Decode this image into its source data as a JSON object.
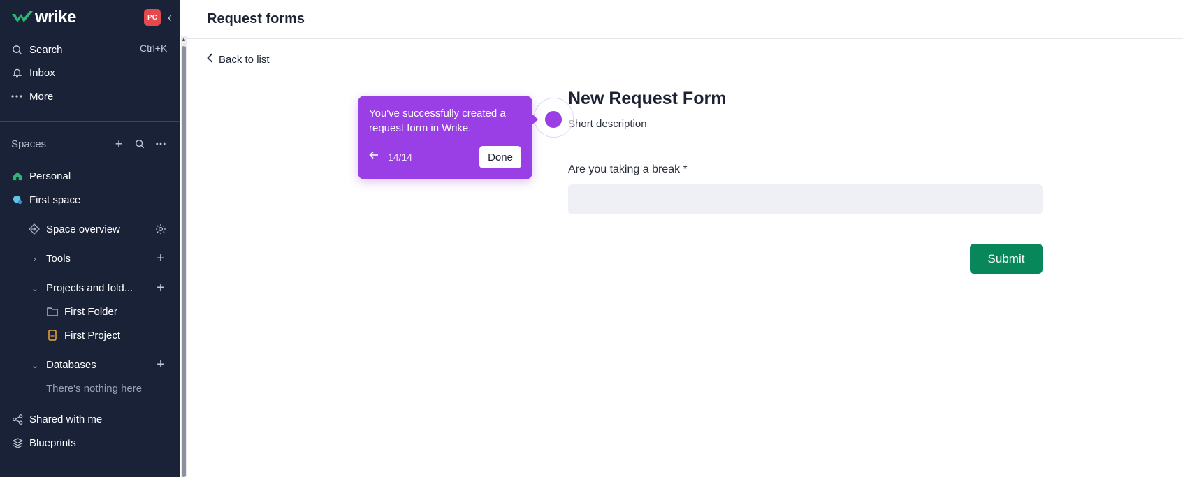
{
  "brand": {
    "name": "wrike",
    "avatar": "PC"
  },
  "sidebar": {
    "search_label": "Search",
    "search_shortcut": "Ctrl+K",
    "inbox_label": "Inbox",
    "more_label": "More",
    "spaces_label": "Spaces",
    "items": {
      "personal": "Personal",
      "first_space": "First space",
      "space_overview": "Space overview",
      "tools": "Tools",
      "projects": "Projects and fold...",
      "first_folder": "First Folder",
      "first_project": "First Project",
      "databases": "Databases",
      "databases_empty": "There's nothing here",
      "shared": "Shared with me",
      "blueprints": "Blueprints"
    }
  },
  "header": {
    "title": "Request forms",
    "back_label": "Back to list"
  },
  "form": {
    "title": "New Request Form",
    "description": "Short description",
    "field_label": "Are you taking a break *",
    "field_value": "",
    "submit_label": "Submit"
  },
  "tooltip": {
    "message": "You've successfully created a request form in Wrike.",
    "step": "14/14",
    "done_label": "Done",
    "prev_icon": "arrow-left"
  },
  "colors": {
    "sidebar_bg": "#1a2238",
    "brand_green": "#2bb673",
    "submit_green": "#08875b",
    "tooltip_purple": "#9a3ee6",
    "avatar_red": "#e5484d"
  }
}
